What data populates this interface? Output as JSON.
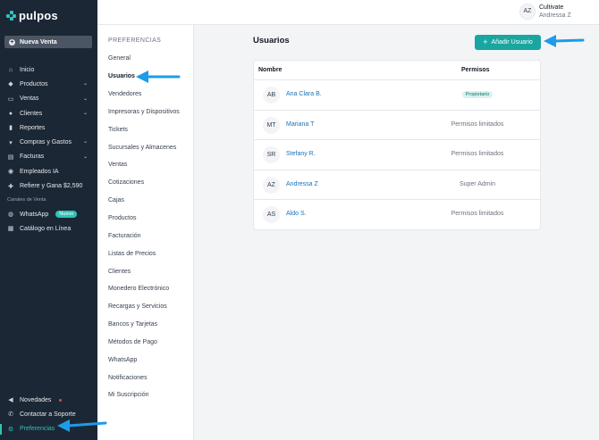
{
  "brand": {
    "name": "pulpos"
  },
  "sidebar": {
    "new_sale": "Nueva Venta",
    "items": [
      {
        "label": "Inicio",
        "icon": "home-icon",
        "chevron": false
      },
      {
        "label": "Productos",
        "icon": "tag-icon",
        "chevron": true
      },
      {
        "label": "Ventas",
        "icon": "receipt-icon",
        "chevron": true
      },
      {
        "label": "Clientes",
        "icon": "clients-icon",
        "chevron": true
      },
      {
        "label": "Reportes",
        "icon": "bar-chart-icon",
        "chevron": false
      },
      {
        "label": "Compras y Gastos",
        "icon": "cart-icon",
        "chevron": true
      },
      {
        "label": "Facturas",
        "icon": "invoice-icon",
        "chevron": true
      },
      {
        "label": "Empleados IA",
        "icon": "robot-icon",
        "chevron": false
      },
      {
        "label": "Refiere y Gana $2,590",
        "icon": "gift-icon",
        "chevron": false
      }
    ],
    "channels_label": "Canales de Venta",
    "channels": [
      {
        "label": "WhatsApp",
        "badge": "Nuevo",
        "icon": "whatsapp-icon"
      },
      {
        "label": "Catálogo en Línea",
        "icon": "catalog-icon"
      }
    ],
    "bottom": [
      {
        "label": "Novedades",
        "icon": "megaphone-icon"
      },
      {
        "label": "Contactar a Soporte",
        "icon": "phone-icon"
      },
      {
        "label": "Preferencias",
        "icon": "gear-icon"
      }
    ]
  },
  "header": {
    "avatar": "AZ",
    "account": "Cultivate",
    "user": "Andressa Z"
  },
  "subnav": {
    "title": "PREFERENCIAS",
    "items": [
      "General",
      "Usuarios",
      "Vendedores",
      "Impresoras y Dispositivos",
      "Tickets",
      "Sucursales y Almacenes",
      "Ventas",
      "Cotizaciones",
      "Cajas",
      "Productos",
      "Facturación",
      "Listas de Precios",
      "Clientes",
      "Monedero Electrónico",
      "Recargas y Servicios",
      "Bancos y Tarjetas",
      "Métodos de Pago",
      "WhatsApp",
      "Notificaciones",
      "Mi Suscripción"
    ],
    "active": "Usuarios"
  },
  "main": {
    "title": "Usuarios",
    "add_button": "Añadir Usuario",
    "columns": {
      "name": "Nombre",
      "permissions": "Permisos"
    },
    "users": [
      {
        "initials": "AB",
        "name": "Ana Clara B.",
        "permission": "Propietario",
        "pill": true
      },
      {
        "initials": "MT",
        "name": "Mariana T",
        "permission": "Permisos limitados",
        "pill": false
      },
      {
        "initials": "SR",
        "name": "Stefany R.",
        "permission": "Permisos limitados",
        "pill": false
      },
      {
        "initials": "AZ",
        "name": "Andressa Z",
        "permission": "Super Admin",
        "pill": false
      },
      {
        "initials": "AS",
        "name": "Aldo S.",
        "permission": "Permisos limitados",
        "pill": false
      }
    ]
  },
  "colors": {
    "sidebar_bg": "#1c2735",
    "accent": "#1aa6a0",
    "link": "#1a73b8",
    "annotation_arrow": "#1e9be9"
  }
}
